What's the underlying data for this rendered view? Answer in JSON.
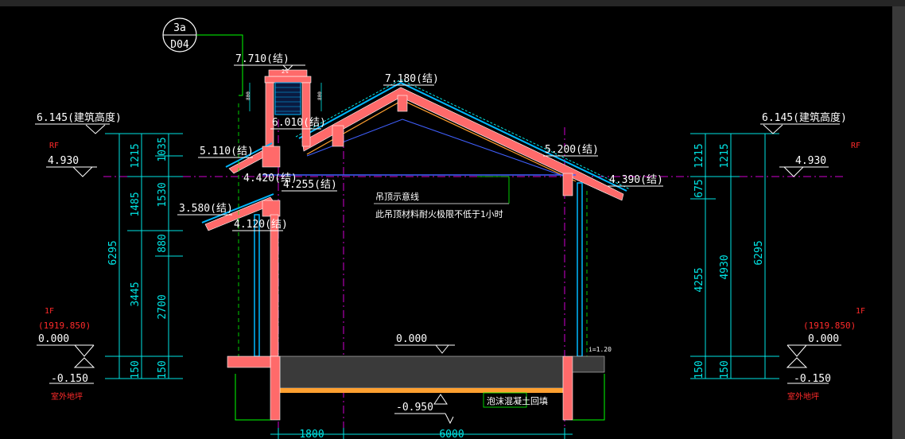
{
  "colors": {
    "background": "#000000",
    "dimension": "#00e5e5",
    "level": "#ffffff",
    "cut_wall": "#ff6a6a",
    "roof_layer": "#00b8ff",
    "axis": "#d000d0",
    "leader": "#00ff00",
    "level_label": "#ff2a2a",
    "foundation": "#ffa030",
    "note": "#ffffff"
  },
  "detail_callout": {
    "top": "3a",
    "bottom": "D04"
  },
  "roof_levels": {
    "chimney_top": "7.710(结)",
    "ridge": "7.180(结)",
    "upper_left_eave": "6.010(结)",
    "left_eave": "5.110(结)",
    "right_eave_upper": "5.200(结)",
    "mid_left_1": "4.420(结)",
    "mid_left_2": "4.255(结)",
    "right_eave_lower": "4.390(结)",
    "lower_left": "3.580(结)",
    "lower_left_2": "4.120(结)",
    "slope": "2%"
  },
  "left_levels": {
    "building_height": "6.145(建筑高度)",
    "rf_label": "RF",
    "rf_value": "4.930",
    "f1_label": "1F",
    "f1_abs": "(1919.850)",
    "f1_value": "0.000",
    "outdoor_value": "-0.150",
    "outdoor_label": "室外地坪"
  },
  "right_levels": {
    "building_height": "6.145(建筑高度)",
    "rf_label": "RF",
    "rf_value": "4.930",
    "f1_label": "1F",
    "f1_abs": "(1919.850)",
    "f1_value": "0.000",
    "outdoor_value": "-0.150",
    "outdoor_label": "室外地坪"
  },
  "left_dims_outer": [
    "6295",
    "150"
  ],
  "left_dims_inner": [
    "1215",
    "1485",
    "3445",
    "150"
  ],
  "left_dims_third": [
    "1035",
    "1530",
    "880",
    "2700",
    "150"
  ],
  "right_dims_inner": [
    "1215",
    "675",
    "4255",
    "150"
  ],
  "right_dims_mid": [
    "1215",
    "4930",
    "150"
  ],
  "right_dims_outer": [
    "6295"
  ],
  "notes": {
    "ceiling_line": "吊顶示意线",
    "ceiling_fire": "此吊顶材料耐火极限不低于1小时",
    "floor_level": "0.000",
    "fill_note": "泡沫混凝土回填",
    "pit_level": "-0.950",
    "slope_tag": "i=1.20"
  },
  "bottom_dims": [
    "1800",
    "6000"
  ]
}
